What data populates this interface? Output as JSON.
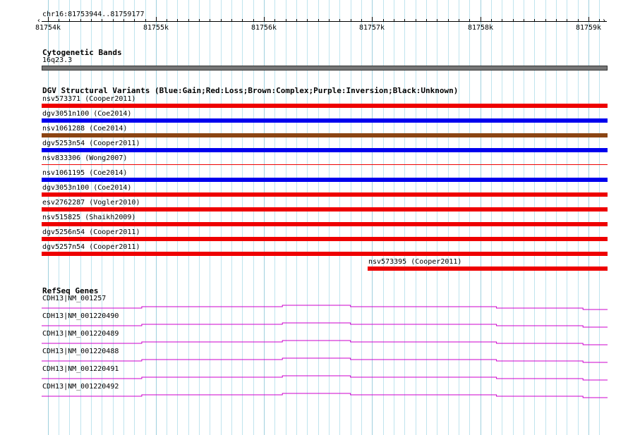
{
  "locus": "chr16:81753944..81759177",
  "ruler": {
    "start": 81753944,
    "end": 81759177,
    "major_ticks": [
      {
        "pos": 81754000,
        "label": "81754k"
      },
      {
        "pos": 81755000,
        "label": "81755k"
      },
      {
        "pos": 81756000,
        "label": "81756k"
      },
      {
        "pos": 81757000,
        "label": "81757k"
      },
      {
        "pos": 81758000,
        "label": "81758k"
      },
      {
        "pos": 81759000,
        "label": "81759k"
      }
    ],
    "minor_step": 100
  },
  "tracks": {
    "cytoband": {
      "title": "Cytogenetic Bands",
      "band_label": "16q23.3",
      "color": "#777777"
    },
    "dgv": {
      "title": "DGV Structural Variants (Blue:Gain;Red:Loss;Brown:Complex;Purple:Inversion;Black:Unknown)",
      "colors": {
        "gain": "#0000ee",
        "loss": "#ee0000",
        "complex": "#8b4513",
        "inversion": "#800080",
        "unknown": "#000000"
      },
      "features": [
        {
          "label": "nsv573371 (Cooper2011)",
          "type": "loss",
          "start": 81753944,
          "end": 81759177,
          "thickness": "thick"
        },
        {
          "label": "dgv3051n100 (Coe2014)",
          "type": "gain",
          "start": 81753944,
          "end": 81759177,
          "thickness": "thick"
        },
        {
          "label": "nsv1061288 (Coe2014)",
          "type": "complex",
          "start": 81753944,
          "end": 81759177,
          "thickness": "thick"
        },
        {
          "label": "dgv5253n54 (Cooper2011)",
          "type": "gain",
          "start": 81753944,
          "end": 81759177,
          "thickness": "thick"
        },
        {
          "label": "nsv833306 (Wong2007)",
          "type": "loss",
          "start": 81753944,
          "end": 81759177,
          "thickness": "thin"
        },
        {
          "label": "nsv1061195 (Coe2014)",
          "type": "gain",
          "start": 81753944,
          "end": 81759177,
          "thickness": "thick"
        },
        {
          "label": "dgv3053n100 (Coe2014)",
          "type": "loss",
          "start": 81753944,
          "end": 81759177,
          "thickness": "thick"
        },
        {
          "label": "esv2762287 (Vogler2010)",
          "type": "loss",
          "start": 81753944,
          "end": 81759177,
          "thickness": "thick"
        },
        {
          "label": "nsv515825 (Shaikh2009)",
          "type": "loss",
          "start": 81753944,
          "end": 81759177,
          "thickness": "thick"
        },
        {
          "label": "dgv5256n54 (Cooper2011)",
          "type": "loss",
          "start": 81753944,
          "end": 81759177,
          "thickness": "thick"
        },
        {
          "label": "dgv5257n54 (Cooper2011)",
          "type": "loss",
          "start": 81753944,
          "end": 81759177,
          "thickness": "thick"
        },
        {
          "label": "nsv573395 (Cooper2011)",
          "type": "loss",
          "start": 81756960,
          "end": 81759177,
          "thickness": "thick"
        }
      ]
    },
    "refseq": {
      "title": "RefSeq Genes",
      "color": "#cc00cc",
      "transcripts": [
        {
          "label": "CDH13|NM_001257"
        },
        {
          "label": "CDH13|NM_001220490"
        },
        {
          "label": "CDH13|NM_001220489"
        },
        {
          "label": "CDH13|NM_001220488"
        },
        {
          "label": "CDH13|NM_001220491"
        },
        {
          "label": "CDH13|NM_001220492"
        }
      ],
      "intron_profile": [
        {
          "start": 81753944,
          "end": 81754870,
          "level": 0
        },
        {
          "start": 81754870,
          "end": 81756170,
          "level": 1
        },
        {
          "start": 81756170,
          "end": 81756800,
          "level": 2
        },
        {
          "start": 81756800,
          "end": 81758150,
          "level": 1
        },
        {
          "start": 81758150,
          "end": 81758950,
          "level": 0
        },
        {
          "start": 81758950,
          "end": 81759177,
          "level": -1
        }
      ]
    }
  }
}
